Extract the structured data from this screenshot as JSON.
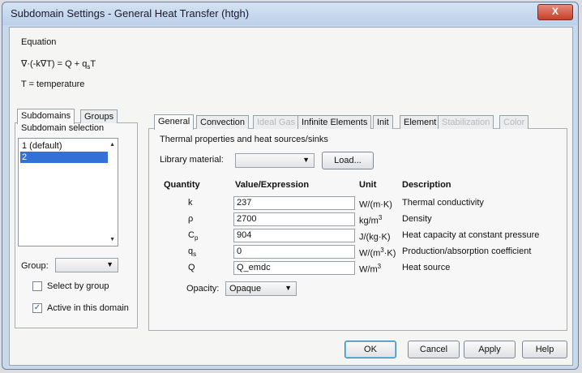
{
  "window": {
    "title": "Subdomain Settings - General Heat Transfer (htgh)",
    "close_label": "X"
  },
  "equation": {
    "label": "Equation",
    "formula": "∇·(-k∇T) = Q + q",
    "formula_sub": "s",
    "formula_tail": "T",
    "temperature_def": "T = temperature"
  },
  "left_tabs": [
    "Subdomains",
    "Groups"
  ],
  "subdomain_selection": {
    "label": "Subdomain selection",
    "items": [
      "1 (default)",
      "2"
    ],
    "selected_index": 1
  },
  "group": {
    "label": "Group:",
    "value": ""
  },
  "checkboxes": [
    {
      "label": "Select by group",
      "checked": false
    },
    {
      "label": "Active in this domain",
      "checked": true
    }
  ],
  "right_tabs": [
    {
      "label": "General",
      "active": true,
      "disabled": false
    },
    {
      "label": "Convection",
      "active": false,
      "disabled": false
    },
    {
      "label": "Ideal Gas",
      "active": false,
      "disabled": true
    },
    {
      "label": "Infinite Elements",
      "active": false,
      "disabled": false
    },
    {
      "label": "Init",
      "active": false,
      "disabled": false
    },
    {
      "label": "Element",
      "active": false,
      "disabled": false
    },
    {
      "label": "Stabilization",
      "active": false,
      "disabled": true
    },
    {
      "label": "Color",
      "active": false,
      "disabled": true
    }
  ],
  "general": {
    "section_title": "Thermal properties and heat sources/sinks",
    "library_label": "Library material:",
    "library_value": "",
    "load_label": "Load...",
    "headers": {
      "quantity": "Quantity",
      "value": "Value/Expression",
      "unit": "Unit",
      "description": "Description"
    },
    "rows": [
      {
        "quantity": "k",
        "quantity_sub": "",
        "value": "237",
        "unit": "W/(m·K)",
        "unit_sup": "",
        "unit_tail": "",
        "description": "Thermal conductivity"
      },
      {
        "quantity": "ρ",
        "quantity_sub": "",
        "value": "2700",
        "unit": "kg/m",
        "unit_sup": "3",
        "unit_tail": "",
        "description": "Density"
      },
      {
        "quantity": "C",
        "quantity_sub": "p",
        "value": "904",
        "unit": "J/(kg·K)",
        "unit_sup": "",
        "unit_tail": "",
        "description": "Heat capacity at constant pressure"
      },
      {
        "quantity": "q",
        "quantity_sub": "s",
        "value": "0",
        "unit": "W/(m",
        "unit_sup": "3",
        "unit_tail": "·K)",
        "description": "Production/absorption coefficient"
      },
      {
        "quantity": "Q",
        "quantity_sub": "",
        "value": "Q_emdc",
        "unit": "W/m",
        "unit_sup": "3",
        "unit_tail": "",
        "description": "Heat source"
      }
    ],
    "opacity_label": "Opacity:",
    "opacity_value": "Opaque"
  },
  "buttons": {
    "ok": "OK",
    "cancel": "Cancel",
    "apply": "Apply",
    "help": "Help"
  }
}
